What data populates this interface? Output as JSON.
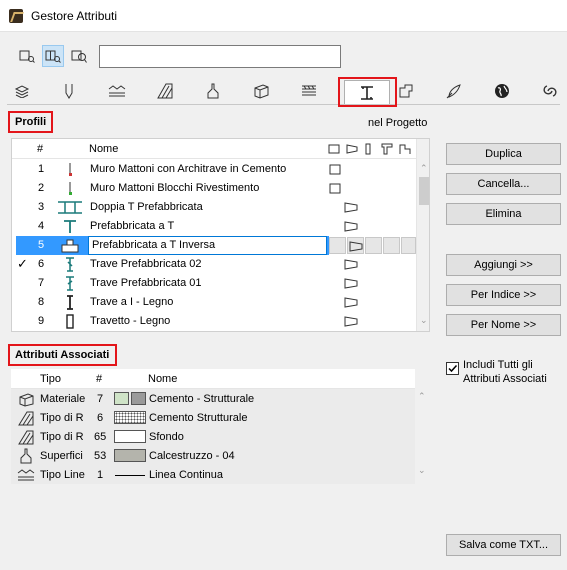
{
  "window": {
    "title": "Gestore Attributi"
  },
  "search": {
    "value": ""
  },
  "view_buttons": [
    "list-view-icon",
    "split-view-icon",
    "preview-view-icon"
  ],
  "tabs": [
    "layers-icon",
    "pen-icon",
    "line-type-icon",
    "fill-icon",
    "surface-icon",
    "building-material-icon",
    "composite-icon",
    "profile-icon",
    "zone-icon",
    "mep-icon",
    "globe-icon",
    "operation-profile-icon"
  ],
  "profiles": {
    "label": "Profili",
    "scope": "nel Progetto",
    "columns": {
      "num": "#",
      "name": "Nome"
    },
    "rows": [
      {
        "check": "",
        "num": "1",
        "name": "Muro Mattoni con Architrave in Cemento",
        "flags": [
          "wall"
        ]
      },
      {
        "check": "",
        "num": "2",
        "name": "Muro Mattoni Blocchi Rivestimento",
        "flags": [
          "wall"
        ]
      },
      {
        "check": "",
        "num": "3",
        "name": "Doppia T Prefabbricata",
        "flags": [
          "beam"
        ]
      },
      {
        "check": "",
        "num": "4",
        "name": "Prefabbricata a T",
        "flags": [
          "beam"
        ]
      },
      {
        "check": "",
        "num": "5",
        "name": "Prefabbricata a T Inversa",
        "flags": [
          "beam"
        ]
      },
      {
        "check": "✓",
        "num": "6",
        "name": "Trave Prefabbricata 02",
        "flags": [
          "beam"
        ]
      },
      {
        "check": "",
        "num": "7",
        "name": "Trave Prefabbricata 01",
        "flags": [
          "beam"
        ]
      },
      {
        "check": "",
        "num": "8",
        "name": "Trave a I - Legno",
        "flags": [
          "beam"
        ]
      },
      {
        "check": "",
        "num": "9",
        "name": "Travetto - Legno",
        "flags": [
          "beam"
        ]
      }
    ],
    "selected_index": 4
  },
  "buttons": {
    "duplicate": "Duplica",
    "delete": "Cancella...",
    "remove": "Elimina",
    "add": "Aggiungi >>",
    "by_index": "Per Indice >>",
    "by_name": "Per Nome >>",
    "save_txt": "Salva come TXT..."
  },
  "associated": {
    "label": "Attributi Associati",
    "columns": {
      "type": "Tipo",
      "num": "#",
      "name": "Nome"
    },
    "rows": [
      {
        "icon": "building-material-icon",
        "type": "Materiale",
        "num": "7",
        "name": "Cemento - Strutturale"
      },
      {
        "icon": "fill-icon",
        "type": "Tipo di R",
        "num": "6",
        "name": "Cemento Strutturale"
      },
      {
        "icon": "fill-icon",
        "type": "Tipo di R",
        "num": "65",
        "name": "Sfondo"
      },
      {
        "icon": "surface-icon",
        "type": "Superfici",
        "num": "53",
        "name": "Calcestruzzo - 04"
      },
      {
        "icon": "line-type-icon",
        "type": "Tipo Line",
        "num": "1",
        "name": "Linea Continua"
      }
    ],
    "include_all_label": "Includi Tutti gli Attributi Associati",
    "include_all_checked": true
  }
}
